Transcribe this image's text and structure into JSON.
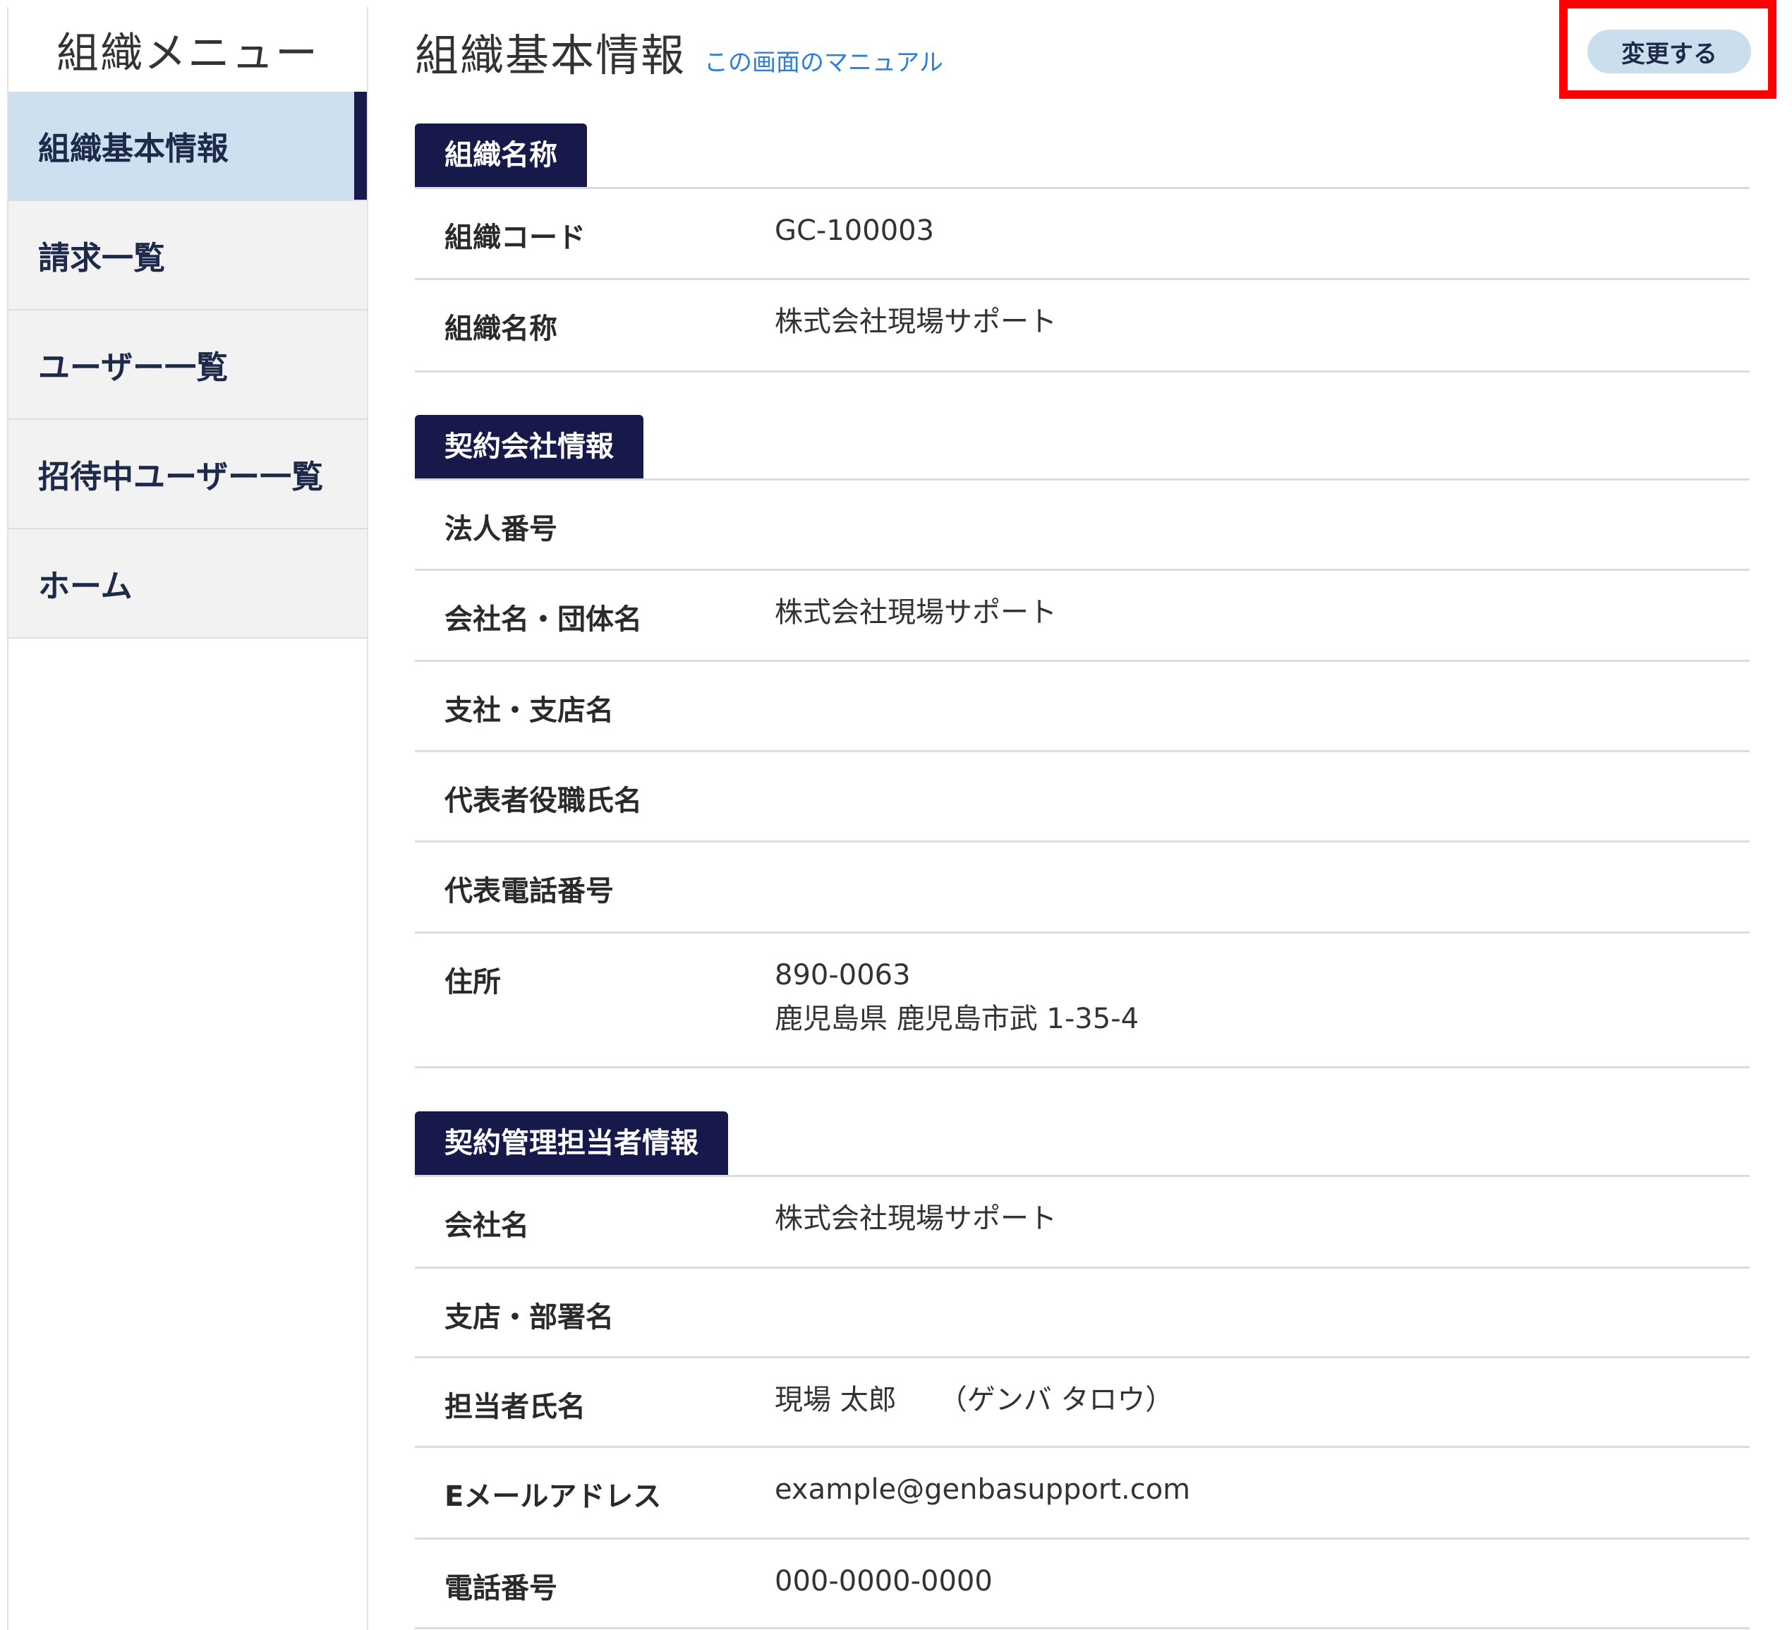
{
  "sidebar": {
    "title": "組織メニュー",
    "items": [
      {
        "label": "組織基本情報",
        "active": true
      },
      {
        "label": "請求一覧",
        "active": false
      },
      {
        "label": "ユーザー一覧",
        "active": false
      },
      {
        "label": "招待中ユーザー一覧",
        "active": false
      },
      {
        "label": "ホーム",
        "active": false
      }
    ]
  },
  "header": {
    "title": "組織基本情報",
    "manual_link": "この画面のマニュアル",
    "edit_button": "変更する"
  },
  "sections": {
    "org": {
      "label": "組織名称",
      "rows": [
        {
          "label": "組織コード",
          "value": "GC-100003"
        },
        {
          "label": "組織名称",
          "value": "株式会社現場サポート"
        }
      ]
    },
    "company": {
      "label": "契約会社情報",
      "rows": [
        {
          "label": "法人番号",
          "value": ""
        },
        {
          "label": "会社名・団体名",
          "value": "株式会社現場サポート"
        },
        {
          "label": "支社・支店名",
          "value": ""
        },
        {
          "label": "代表者役職氏名",
          "value": ""
        },
        {
          "label": "代表電話番号",
          "value": ""
        },
        {
          "label": "住所",
          "postal": "890-0063",
          "address": "鹿児島県 鹿児島市武 1-35-4"
        }
      ]
    },
    "contact": {
      "label": "契約管理担当者情報",
      "rows": [
        {
          "label": "会社名",
          "value": "株式会社現場サポート"
        },
        {
          "label": "支店・部署名",
          "value": ""
        },
        {
          "label": "担当者氏名",
          "value": "現場 太郎",
          "kana": "（ゲンバ タロウ）"
        },
        {
          "label": "Eメールアドレス",
          "value": "example@genbasupport.com"
        },
        {
          "label": "電話番号",
          "value": "000-0000-0000"
        }
      ]
    }
  },
  "colors": {
    "navy": "#16194a",
    "active_bg": "#cde0ef",
    "link": "#2e7fd6",
    "highlight": "#ff0000"
  }
}
